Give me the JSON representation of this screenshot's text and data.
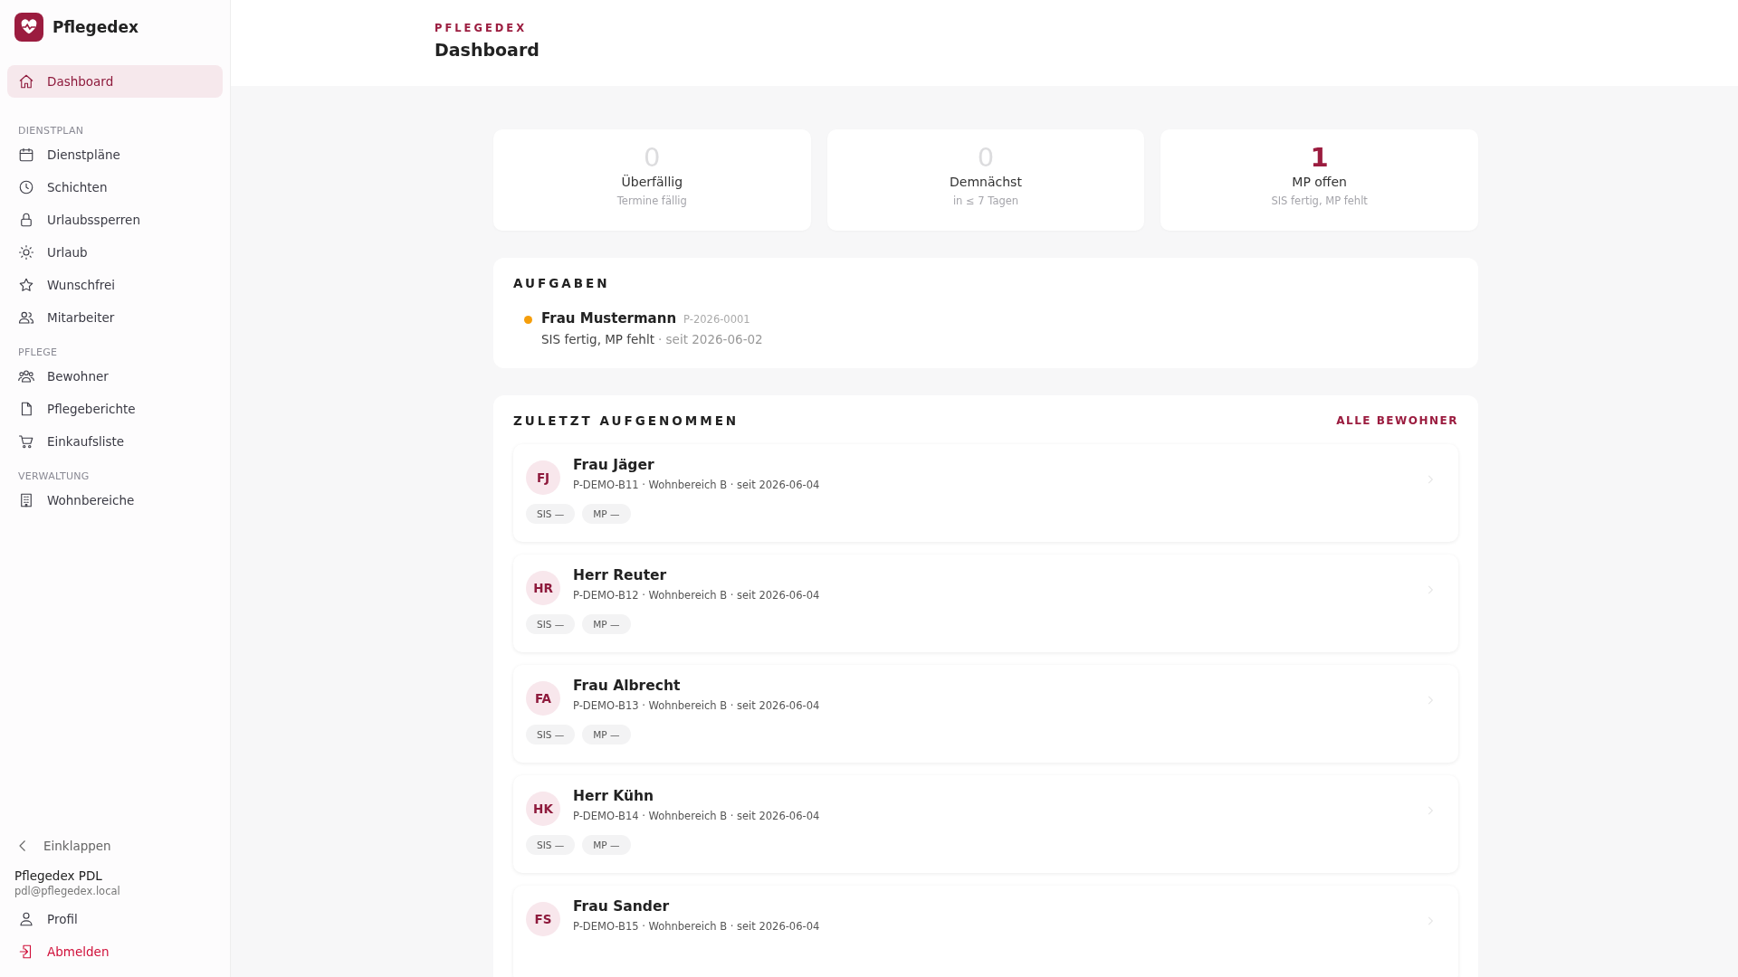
{
  "sidebar": {
    "brand": "Pflegedex",
    "sections": [
      {
        "items": [
          {
            "label": "Dashboard",
            "selected": true
          }
        ]
      },
      {
        "heading": "DIENSTPLAN",
        "items": [
          {
            "label": "Dienstpläne",
            "selected": false
          },
          {
            "label": "Schichten",
            "selected": false
          },
          {
            "label": "Urlaubssperren",
            "selected": false
          },
          {
            "label": "Urlaub",
            "selected": false
          },
          {
            "label": "Wunschfrei",
            "selected": false
          },
          {
            "label": "Mitarbeiter",
            "selected": false
          }
        ]
      },
      {
        "heading": "PFLEGE",
        "items": [
          {
            "label": "Bewohner",
            "selected": false
          },
          {
            "label": "Pflegeberichte",
            "selected": false
          },
          {
            "label": "Einkaufsliste",
            "selected": false
          }
        ]
      },
      {
        "heading": "VERWALTUNG",
        "items": [
          {
            "label": "Wohnbereiche",
            "selected": false
          }
        ]
      }
    ],
    "collapse": "Einklappen",
    "user": {
      "name": "Pflegedex PDL",
      "email": "pdl@pflegedex.local"
    },
    "profile": "Profil",
    "logout": "Abmelden"
  },
  "header": {
    "eyebrow": "PFLEGEDEX",
    "title": "Dashboard"
  },
  "stats": [
    {
      "value": "0",
      "label": "Überfällig",
      "sub": "Termine fällig",
      "alert": false
    },
    {
      "value": "0",
      "label": "Demnächst",
      "sub": "in ≤ 7 Tagen",
      "alert": false
    },
    {
      "value": "1",
      "label": "MP offen",
      "sub": "SIS fertig, MP fehlt",
      "alert": true
    }
  ],
  "tasks": {
    "title": "AUFGABEN",
    "items": [
      {
        "name": "Frau Mustermann",
        "id": "P-2026-0001",
        "status": "SIS fertig, MP fehlt",
        "since": "· seit 2026-06-02",
        "color": "#f59e0b"
      }
    ]
  },
  "recent": {
    "title": "ZULETZT AUFGENOMMEN",
    "link": "ALLE BEWOHNER",
    "residents": [
      {
        "initials": "FJ",
        "name": "Frau Jäger",
        "meta": "P-DEMO-B11 · Wohnbereich B · seit 2026-06-04",
        "tags": [
          "SIS —",
          "MP —"
        ]
      },
      {
        "initials": "HR",
        "name": "Herr Reuter",
        "meta": "P-DEMO-B12 · Wohnbereich B · seit 2026-06-04",
        "tags": [
          "SIS —",
          "MP —"
        ]
      },
      {
        "initials": "FA",
        "name": "Frau Albrecht",
        "meta": "P-DEMO-B13 · Wohnbereich B · seit 2026-06-04",
        "tags": [
          "SIS —",
          "MP —"
        ]
      },
      {
        "initials": "HK",
        "name": "Herr Kühn",
        "meta": "P-DEMO-B14 · Wohnbereich B · seit 2026-06-04",
        "tags": [
          "SIS —",
          "MP —"
        ]
      },
      {
        "initials": "FS",
        "name": "Frau Sander",
        "meta": "P-DEMO-B15 · Wohnbereich B · seit 2026-06-04"
      }
    ]
  }
}
